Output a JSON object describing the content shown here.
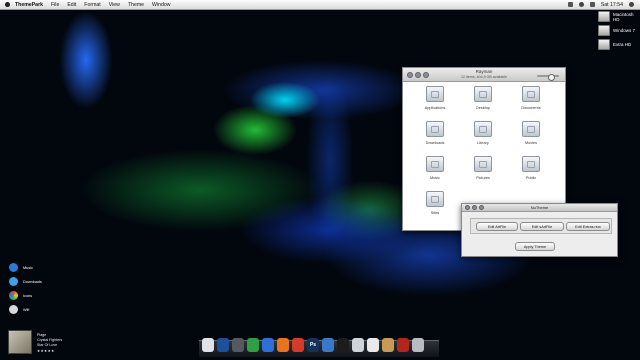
{
  "menubar": {
    "app_name": "ThemePark",
    "items": [
      "File",
      "Edit",
      "Format",
      "View",
      "Theme",
      "Window"
    ],
    "clock": "Sat 17:54"
  },
  "desktop": {
    "drives": [
      {
        "label": "Macintosh HD",
        "icon": "hard-drive-icon"
      },
      {
        "label": "Windows 7",
        "icon": "hard-drive-icon"
      },
      {
        "label": "Extra HD",
        "icon": "hard-drive-icon"
      }
    ]
  },
  "finder": {
    "title": "Rayman",
    "status": "12 items, 404,9 GB available",
    "items": [
      {
        "label": "Applications",
        "icon": "applications-folder-icon"
      },
      {
        "label": "Desktop",
        "icon": "desktop-folder-icon"
      },
      {
        "label": "Documents",
        "icon": "documents-folder-icon"
      },
      {
        "label": "Downloads",
        "icon": "downloads-folder-icon"
      },
      {
        "label": "Library",
        "icon": "library-folder-icon"
      },
      {
        "label": "Movies",
        "icon": "movies-folder-icon"
      },
      {
        "label": "Music",
        "icon": "music-folder-icon"
      },
      {
        "label": "Pictures",
        "icon": "pictures-folder-icon"
      },
      {
        "label": "Public",
        "icon": "public-folder-icon"
      },
      {
        "label": "Sites",
        "icon": "sites-folder-icon"
      }
    ]
  },
  "nutheme": {
    "title": "NuTheme",
    "buttons": {
      "edit_arrfile": "Edit ArtFile",
      "edit_sarfile": "Edit sArtFile",
      "edit_extras": "Edit Extras.rsrc",
      "apply": "Apply Theme"
    }
  },
  "stack": [
    {
      "label": "Music",
      "color": "#2a7bd6"
    },
    {
      "label": "Downloads",
      "color": "#3fa0e8"
    },
    {
      "label": "Icons",
      "color": "#e24a3a"
    },
    {
      "label": "Wifi",
      "color": "#d8d8d8"
    }
  ],
  "now_playing": {
    "track": "Plage",
    "artist": "Crystal Fighters",
    "album": "Star Of Love",
    "rating": "★★★★★"
  },
  "dock": {
    "items": [
      {
        "icon": "finder-icon",
        "color": "#dfe3e8",
        "glyph": ""
      },
      {
        "icon": "system-preferences-icon",
        "color": "#1e4f9a",
        "glyph": ""
      },
      {
        "icon": "stopwatch-icon",
        "color": "#555a60",
        "glyph": ""
      },
      {
        "icon": "chrome-icon",
        "color": "#2f9e44",
        "glyph": ""
      },
      {
        "icon": "internet-explorer-icon",
        "color": "#2d6fd6",
        "glyph": ""
      },
      {
        "icon": "firefox-icon",
        "color": "#e8731f",
        "glyph": ""
      },
      {
        "icon": "tomato-app-icon",
        "color": "#d63a2a",
        "glyph": ""
      },
      {
        "icon": "photoshop-icon",
        "color": "#15335a",
        "glyph": "Ps"
      },
      {
        "icon": "sphere-icon",
        "color": "#3a78c9",
        "glyph": ""
      },
      {
        "icon": "dark-app-icon",
        "color": "#1c1c1c",
        "glyph": ""
      },
      {
        "icon": "preview-icon",
        "color": "#cfd4da",
        "glyph": ""
      },
      {
        "icon": "document-icon",
        "color": "#e9e9e9",
        "glyph": ""
      },
      {
        "icon": "cardboard-box-icon",
        "color": "#c89a55",
        "glyph": ""
      },
      {
        "icon": "mailbox-icon",
        "color": "#b3261e",
        "glyph": ""
      },
      {
        "icon": "trash-icon",
        "color": "#b8bcc2",
        "glyph": ""
      }
    ]
  }
}
